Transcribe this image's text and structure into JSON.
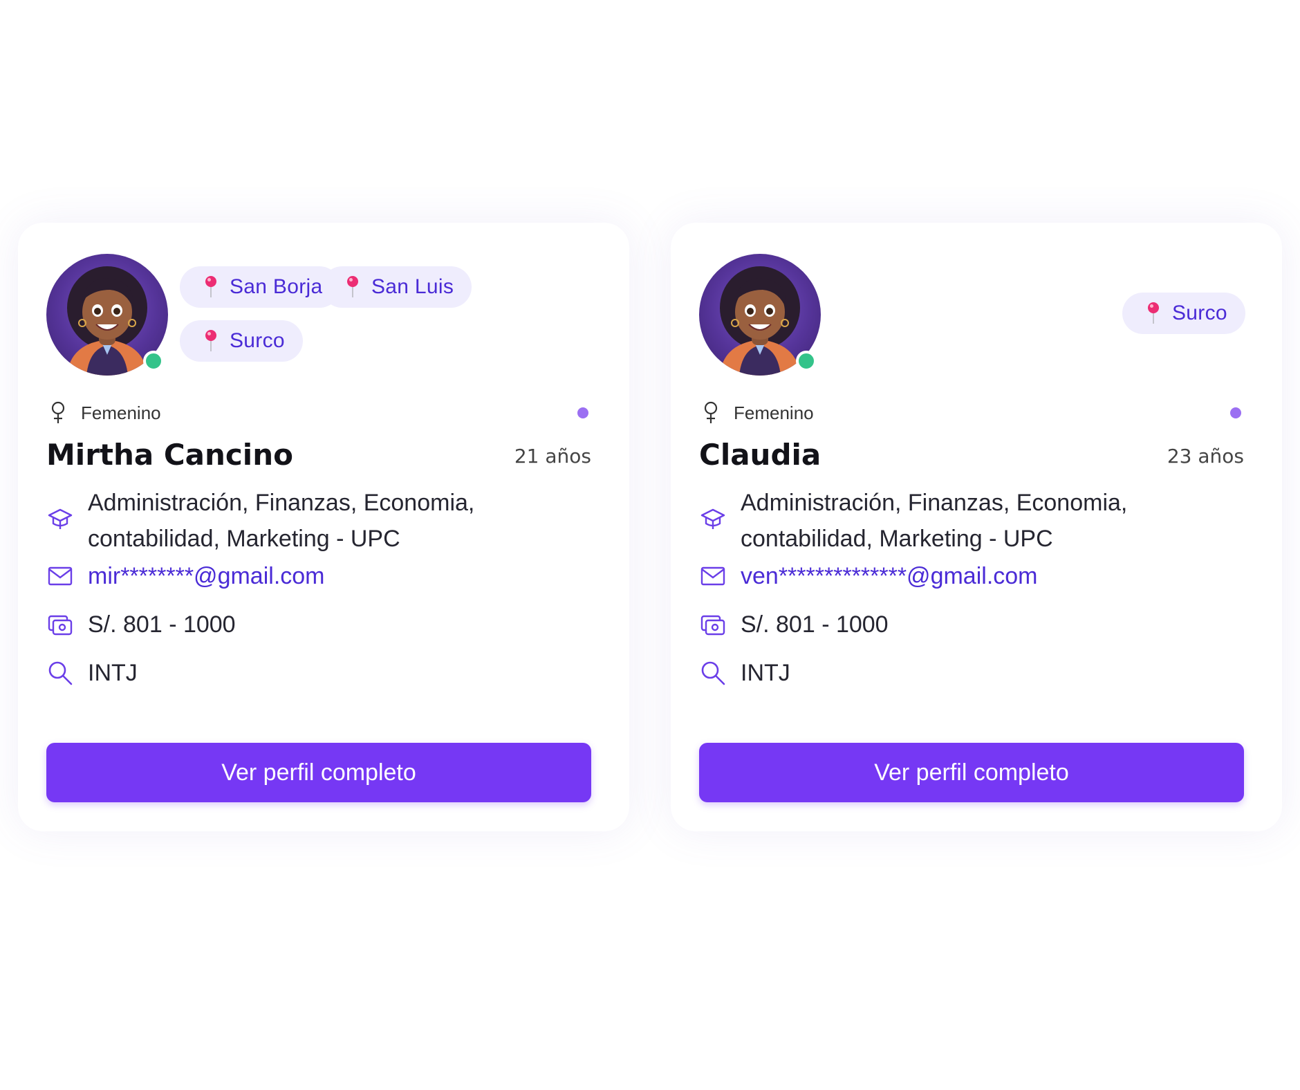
{
  "accent_color": "#7638f4",
  "chip_text_color": "#4a2bd6",
  "status_online_color": "#34c38a",
  "cards": [
    {
      "avatar_icon": "avatar-image",
      "online": true,
      "locations": [
        "San Borja",
        "San Luis",
        "Surco"
      ],
      "gender": "Femenino",
      "gender_icon": "female-icon",
      "name": "Mirtha Cancino",
      "age": "21 años",
      "career_line1": "Administración, Finanzas, Economia,",
      "career_line2": "contabilidad, Marketing - UPC",
      "email": "mir********@gmail.com",
      "salary": "S/. 801 - 1000",
      "mbti": "INTJ",
      "button_label": "Ver perfil completo"
    },
    {
      "avatar_icon": "avatar-image",
      "online": true,
      "locations": [
        "Surco"
      ],
      "gender": "Femenino",
      "gender_icon": "female-icon",
      "name": "Claudia",
      "age": "23 años",
      "career_line1": "Administración, Finanzas, Economia,",
      "career_line2": "contabilidad, Marketing - UPC",
      "email": "ven**************@gmail.com",
      "salary": "S/. 801 - 1000",
      "mbti": "INTJ",
      "button_label": "Ver perfil completo"
    }
  ]
}
